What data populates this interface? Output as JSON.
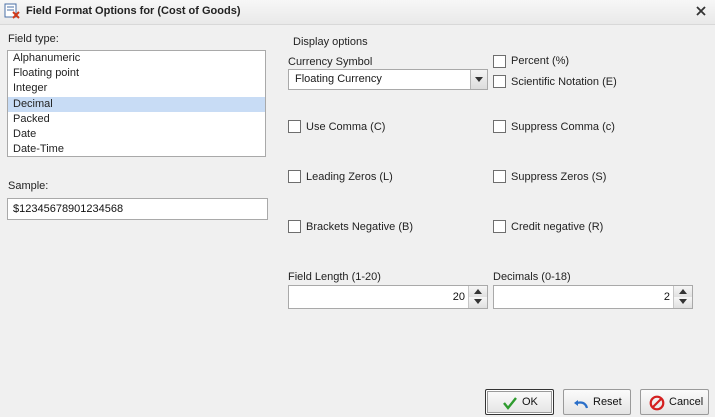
{
  "window": {
    "title": "Field Format Options for (Cost of Goods)"
  },
  "field_type": {
    "label": "Field type:",
    "items": [
      "Alphanumeric",
      "Floating point",
      "Integer",
      "Decimal",
      "Packed",
      "Date",
      "Date-Time"
    ],
    "selected": "Decimal"
  },
  "sample": {
    "label": "Sample:",
    "value": "$12345678901234568"
  },
  "display_options": {
    "heading": "Display options",
    "currency_label": "Currency Symbol",
    "currency_value": "Floating Currency"
  },
  "checkboxes": {
    "percent": {
      "label": "Percent (%)",
      "checked": false
    },
    "scientific": {
      "label": "Scientific Notation (E)",
      "checked": false
    },
    "use_comma": {
      "label": "Use Comma (C)",
      "checked": false
    },
    "suppress_comma": {
      "label": "Suppress Comma (c)",
      "checked": false
    },
    "leading_zeros": {
      "label": "Leading Zeros (L)",
      "checked": false
    },
    "suppress_zeros": {
      "label": "Suppress Zeros (S)",
      "checked": false
    },
    "brackets_negative": {
      "label": "Brackets Negative (B)",
      "checked": false
    },
    "credit_negative": {
      "label": "Credit negative (R)",
      "checked": false
    }
  },
  "field_length": {
    "label": "Field Length (1-20)",
    "value": "20"
  },
  "decimals": {
    "label": "Decimals (0-18)",
    "value": "2"
  },
  "buttons": {
    "ok": "OK",
    "reset": "Reset",
    "cancel": "Cancel"
  },
  "icons": {
    "title": "format-options-icon",
    "close": "close-icon",
    "ok": "checkmark-icon",
    "reset": "undo-arrow-icon",
    "cancel": "cancel-icon"
  },
  "colors": {
    "selection": "#c8dcf5",
    "ok_check": "#2e9b2e",
    "reset_arrow": "#2a6fc9",
    "cancel_red": "#d42020"
  }
}
